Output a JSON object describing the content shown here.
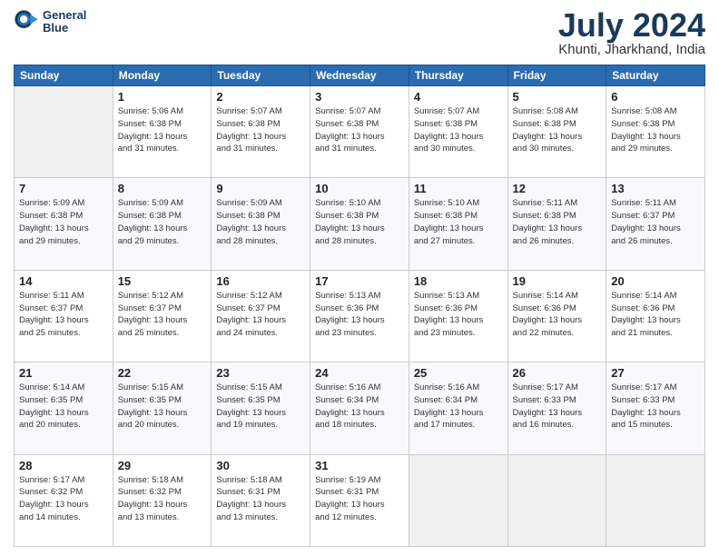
{
  "logo": {
    "line1": "General",
    "line2": "Blue"
  },
  "title": "July 2024",
  "location": "Khunti, Jharkhand, India",
  "days_of_week": [
    "Sunday",
    "Monday",
    "Tuesday",
    "Wednesday",
    "Thursday",
    "Friday",
    "Saturday"
  ],
  "weeks": [
    [
      {
        "day": "",
        "info": ""
      },
      {
        "day": "1",
        "info": "Sunrise: 5:06 AM\nSunset: 6:38 PM\nDaylight: 13 hours\nand 31 minutes."
      },
      {
        "day": "2",
        "info": "Sunrise: 5:07 AM\nSunset: 6:38 PM\nDaylight: 13 hours\nand 31 minutes."
      },
      {
        "day": "3",
        "info": "Sunrise: 5:07 AM\nSunset: 6:38 PM\nDaylight: 13 hours\nand 31 minutes."
      },
      {
        "day": "4",
        "info": "Sunrise: 5:07 AM\nSunset: 6:38 PM\nDaylight: 13 hours\nand 30 minutes."
      },
      {
        "day": "5",
        "info": "Sunrise: 5:08 AM\nSunset: 6:38 PM\nDaylight: 13 hours\nand 30 minutes."
      },
      {
        "day": "6",
        "info": "Sunrise: 5:08 AM\nSunset: 6:38 PM\nDaylight: 13 hours\nand 29 minutes."
      }
    ],
    [
      {
        "day": "7",
        "info": "Sunrise: 5:09 AM\nSunset: 6:38 PM\nDaylight: 13 hours\nand 29 minutes."
      },
      {
        "day": "8",
        "info": "Sunrise: 5:09 AM\nSunset: 6:38 PM\nDaylight: 13 hours\nand 29 minutes."
      },
      {
        "day": "9",
        "info": "Sunrise: 5:09 AM\nSunset: 6:38 PM\nDaylight: 13 hours\nand 28 minutes."
      },
      {
        "day": "10",
        "info": "Sunrise: 5:10 AM\nSunset: 6:38 PM\nDaylight: 13 hours\nand 28 minutes."
      },
      {
        "day": "11",
        "info": "Sunrise: 5:10 AM\nSunset: 6:38 PM\nDaylight: 13 hours\nand 27 minutes."
      },
      {
        "day": "12",
        "info": "Sunrise: 5:11 AM\nSunset: 6:38 PM\nDaylight: 13 hours\nand 26 minutes."
      },
      {
        "day": "13",
        "info": "Sunrise: 5:11 AM\nSunset: 6:37 PM\nDaylight: 13 hours\nand 26 minutes."
      }
    ],
    [
      {
        "day": "14",
        "info": "Sunrise: 5:11 AM\nSunset: 6:37 PM\nDaylight: 13 hours\nand 25 minutes."
      },
      {
        "day": "15",
        "info": "Sunrise: 5:12 AM\nSunset: 6:37 PM\nDaylight: 13 hours\nand 25 minutes."
      },
      {
        "day": "16",
        "info": "Sunrise: 5:12 AM\nSunset: 6:37 PM\nDaylight: 13 hours\nand 24 minutes."
      },
      {
        "day": "17",
        "info": "Sunrise: 5:13 AM\nSunset: 6:36 PM\nDaylight: 13 hours\nand 23 minutes."
      },
      {
        "day": "18",
        "info": "Sunrise: 5:13 AM\nSunset: 6:36 PM\nDaylight: 13 hours\nand 23 minutes."
      },
      {
        "day": "19",
        "info": "Sunrise: 5:14 AM\nSunset: 6:36 PM\nDaylight: 13 hours\nand 22 minutes."
      },
      {
        "day": "20",
        "info": "Sunrise: 5:14 AM\nSunset: 6:36 PM\nDaylight: 13 hours\nand 21 minutes."
      }
    ],
    [
      {
        "day": "21",
        "info": "Sunrise: 5:14 AM\nSunset: 6:35 PM\nDaylight: 13 hours\nand 20 minutes."
      },
      {
        "day": "22",
        "info": "Sunrise: 5:15 AM\nSunset: 6:35 PM\nDaylight: 13 hours\nand 20 minutes."
      },
      {
        "day": "23",
        "info": "Sunrise: 5:15 AM\nSunset: 6:35 PM\nDaylight: 13 hours\nand 19 minutes."
      },
      {
        "day": "24",
        "info": "Sunrise: 5:16 AM\nSunset: 6:34 PM\nDaylight: 13 hours\nand 18 minutes."
      },
      {
        "day": "25",
        "info": "Sunrise: 5:16 AM\nSunset: 6:34 PM\nDaylight: 13 hours\nand 17 minutes."
      },
      {
        "day": "26",
        "info": "Sunrise: 5:17 AM\nSunset: 6:33 PM\nDaylight: 13 hours\nand 16 minutes."
      },
      {
        "day": "27",
        "info": "Sunrise: 5:17 AM\nSunset: 6:33 PM\nDaylight: 13 hours\nand 15 minutes."
      }
    ],
    [
      {
        "day": "28",
        "info": "Sunrise: 5:17 AM\nSunset: 6:32 PM\nDaylight: 13 hours\nand 14 minutes."
      },
      {
        "day": "29",
        "info": "Sunrise: 5:18 AM\nSunset: 6:32 PM\nDaylight: 13 hours\nand 13 minutes."
      },
      {
        "day": "30",
        "info": "Sunrise: 5:18 AM\nSunset: 6:31 PM\nDaylight: 13 hours\nand 13 minutes."
      },
      {
        "day": "31",
        "info": "Sunrise: 5:19 AM\nSunset: 6:31 PM\nDaylight: 13 hours\nand 12 minutes."
      },
      {
        "day": "",
        "info": ""
      },
      {
        "day": "",
        "info": ""
      },
      {
        "day": "",
        "info": ""
      }
    ]
  ]
}
